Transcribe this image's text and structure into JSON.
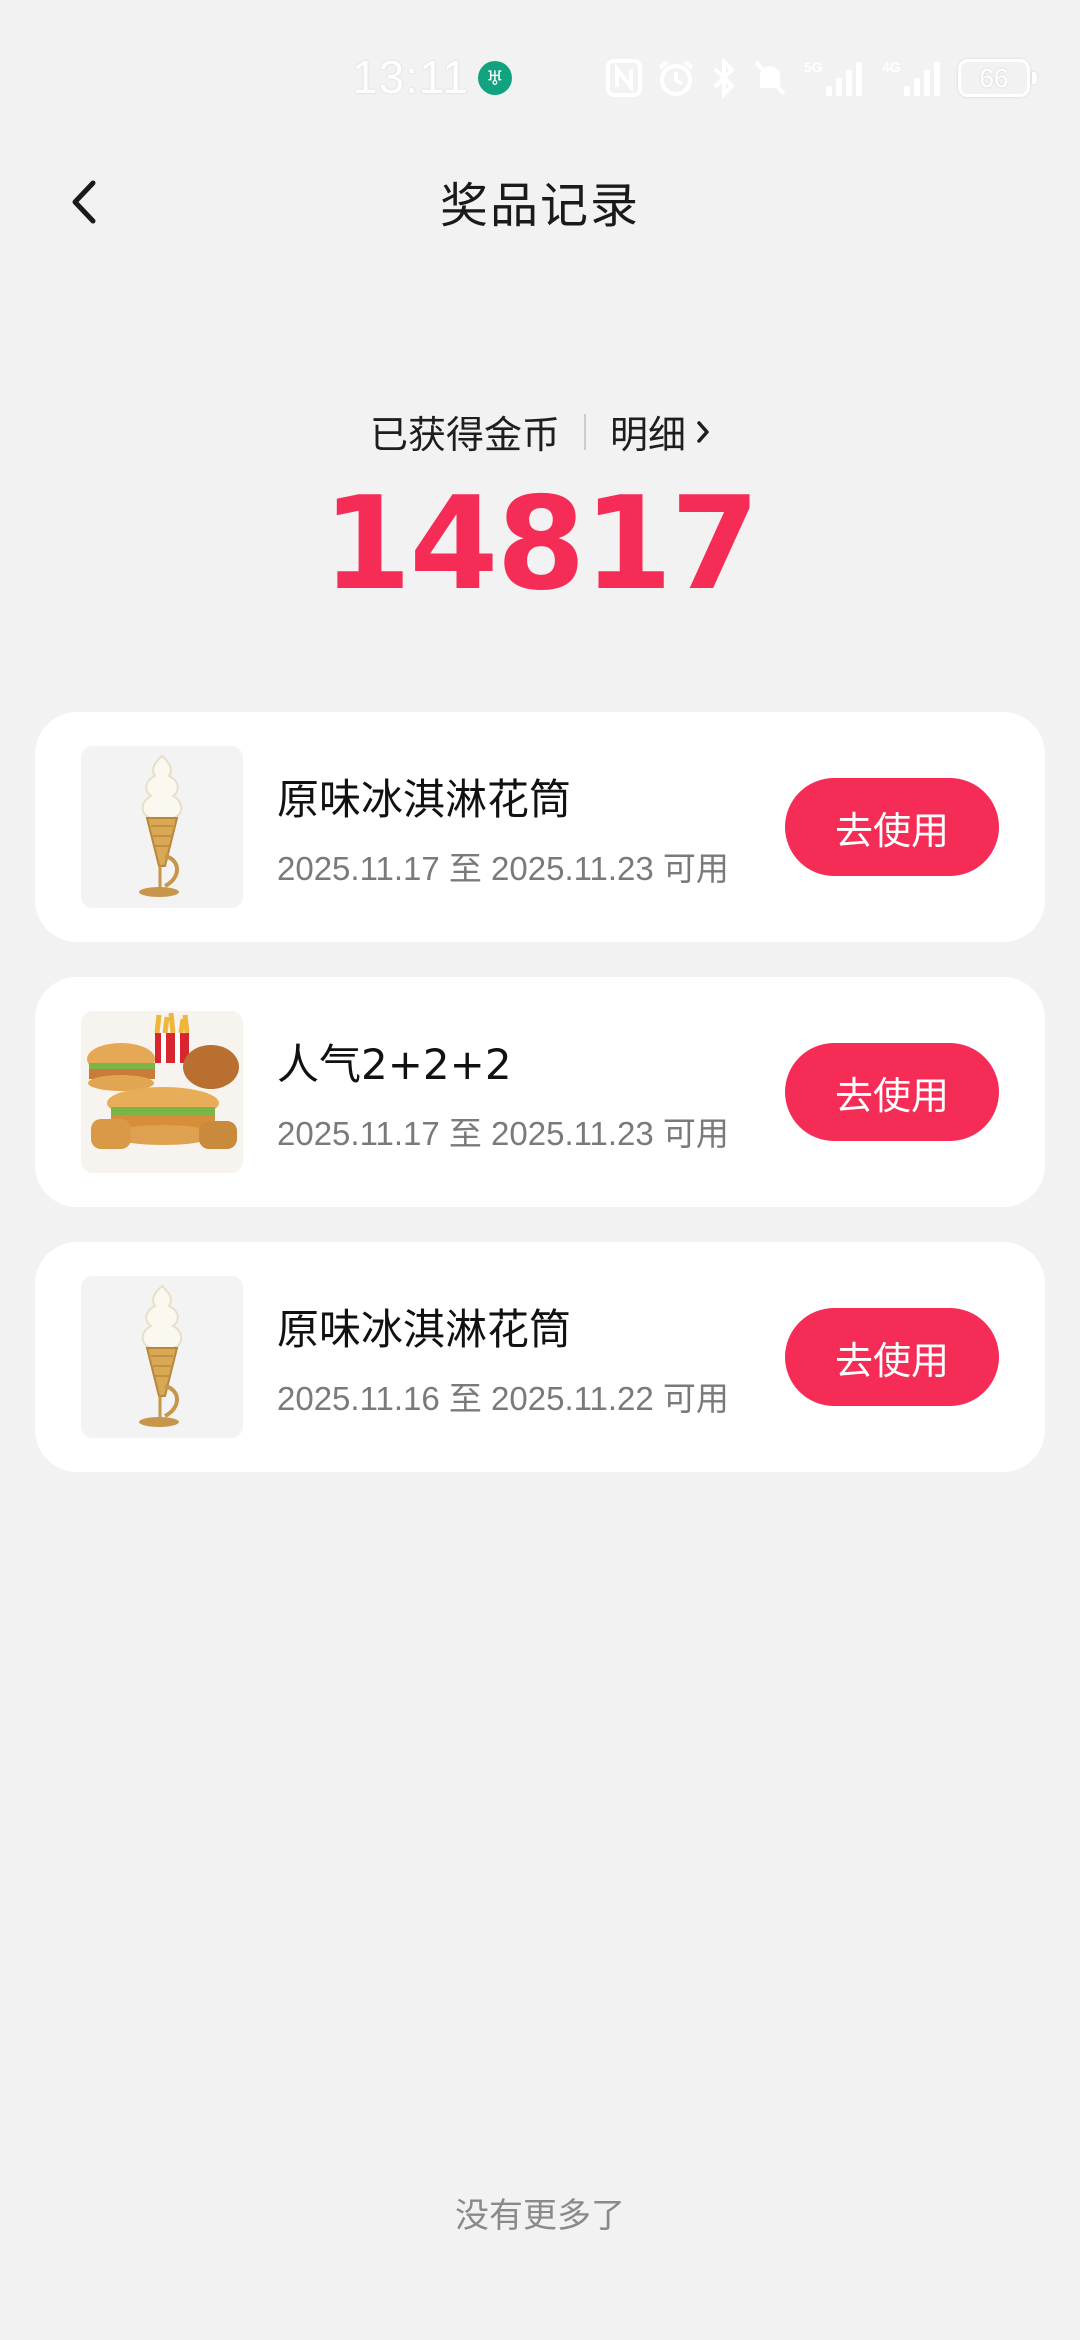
{
  "status_bar": {
    "time": "13:11",
    "battery": "66",
    "network_5g": "5G",
    "network_4g": "4G"
  },
  "header": {
    "title": "奖品记录"
  },
  "summary": {
    "coins_label": "已获得金币",
    "detail_label": "明细",
    "coins_value": "14817"
  },
  "prizes": [
    {
      "title": "原味冰淇淋花筒",
      "validity": "2025.11.17 至 2025.11.23 可用",
      "button": "去使用",
      "image": "ice-cream-cone"
    },
    {
      "title": "人气2+2+2",
      "validity": "2025.11.17 至 2025.11.23 可用",
      "button": "去使用",
      "image": "burger-combo"
    },
    {
      "title": "原味冰淇淋花筒",
      "validity": "2025.11.16 至 2025.11.22 可用",
      "button": "去使用",
      "image": "ice-cream-cone"
    }
  ],
  "footer": {
    "end_text": "没有更多了"
  },
  "colors": {
    "accent": "#f52c56",
    "background": "#f2f2f2",
    "card": "#ffffff"
  }
}
